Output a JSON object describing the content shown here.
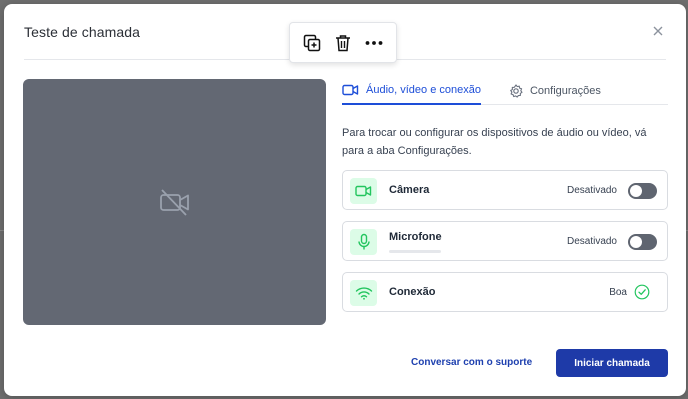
{
  "modal": {
    "title": "Teste de chamada",
    "close_glyph": "✕"
  },
  "toolbar": {
    "icons": [
      "duplicate-icon",
      "trash-icon",
      "more-options-icon"
    ]
  },
  "tabs": [
    {
      "label": "Áudio, vídeo e conexão",
      "icon": "video-camera-icon",
      "active": true
    },
    {
      "label": "Configurações",
      "icon": "gear-icon",
      "active": false
    }
  ],
  "description": "Para trocar ou configurar os dispositivos de áudio ou vídeo, vá para a aba Configurações.",
  "devices": [
    {
      "label": "Câmera",
      "status": "Desativado",
      "icon": "camera-icon",
      "enabled": false
    },
    {
      "label": "Microfone",
      "status": "Desativado",
      "icon": "microphone-icon",
      "enabled": false
    },
    {
      "label": "Conexão",
      "status": "Boa",
      "icon": "wifi-icon",
      "ok": true
    }
  ],
  "footer": {
    "support_label": "Conversar com o suporte",
    "start_label": "Iniciar chamada"
  },
  "colors": {
    "accent": "#1e3aa8",
    "success": "#22c55e",
    "preview_bg": "#636873"
  }
}
